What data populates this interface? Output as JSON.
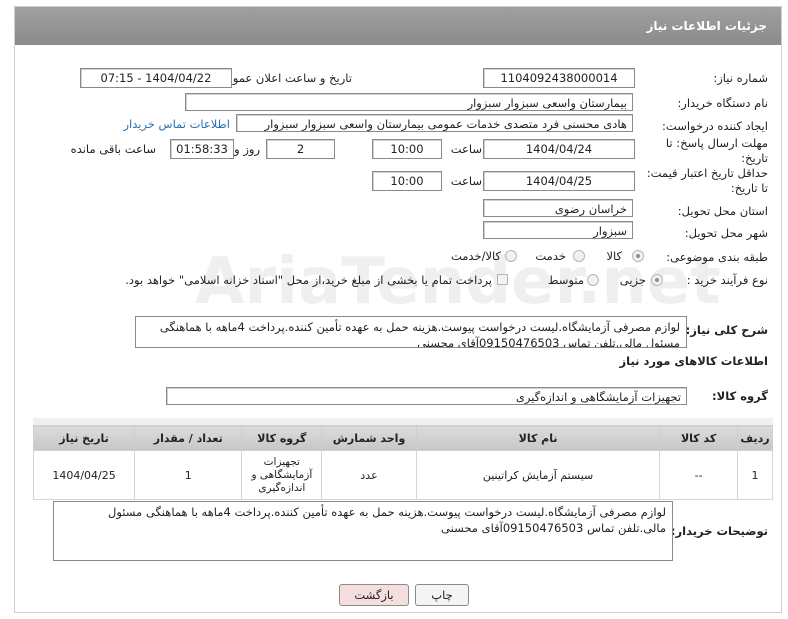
{
  "header": {
    "title": "جزئیات اطلاعات نیاز"
  },
  "form": {
    "need_number_label": "شماره نیاز:",
    "need_number": "1104092438000014",
    "announce_label": "تاریخ و ساعت اعلان عمومی:",
    "announce_value": "1404/04/22 - 07:15",
    "buyer_org_label": "نام دستگاه خریدار:",
    "buyer_org": "بیمارستان واسعی سبزوار سبزوار",
    "creator_label": "ایجاد کننده درخواست:",
    "creator": "هادی محسنی فرد متصدی خدمات عمومی بیمارستان واسعی سبزوار سبزوار",
    "contact_link": "اطلاعات تماس خریدار",
    "deadline_label_1": "مهلت ارسال پاسخ: تا",
    "deadline_label_2": "تاریخ:",
    "deadline_date": "1404/04/24",
    "time_label": "ساعت",
    "deadline_time": "10:00",
    "days_value": "2",
    "days_label": "روز و",
    "remaining_time": "01:58:33",
    "remaining_label": "ساعت باقی مانده",
    "price_label_1": "حداقل تاریخ اعتبار قیمت:",
    "price_label_2": "تا تاریخ:",
    "price_date": "1404/04/25",
    "price_time_label": "ساعت",
    "price_time": "10:00",
    "province_label": "استان محل تحویل:",
    "province": "خراسان رضوی",
    "city_label": "شهر محل تحویل:",
    "city": "سبزوار",
    "category_label": "طبقه بندی موضوعی:",
    "category_options": [
      "کالا",
      "خدمت",
      "کالا/خدمت"
    ],
    "process_label": "نوع فرآیند خرید :",
    "process_options": [
      "جزیی",
      "متوسط"
    ],
    "payment_note": "پرداخت تمام یا بخشی از مبلغ خرید،از محل \"اسناد خزانه اسلامی\" خواهد بود.",
    "description_label": "شرح کلی نیاز:",
    "description": "لوازم مصرفی آزمایشگاه.لیست درخواست پیوست.هزینه حمل به عهده تأمین کننده.پرداخت 4ماهه با هماهنگی مسئول مالی.تلفن تماس 09150476503آقای محسنی"
  },
  "goods": {
    "section_title": "اطلاعات کالاهای مورد نیاز",
    "group_label": "گروه کالا:",
    "group_value": "تجهیزات آزمایشگاهی و اندازه‌گیری",
    "columns": [
      "ردیف",
      "کد کالا",
      "نام کالا",
      "واحد شمارش",
      "گروه کالا",
      "تعداد / مقدار",
      "تاریخ نیاز"
    ],
    "rows": [
      {
        "index": "1",
        "code": "--",
        "name": "سیستم آزمایش کراتینین",
        "unit": "عدد",
        "group": "تجهیزات آزمایشگاهی و اندازه‌گیری",
        "qty": "1",
        "date": "1404/04/25"
      }
    ]
  },
  "buyer_notes": {
    "label": "توضیحات خریدار:",
    "text": "لوازم مصرفی آزمایشگاه.لیست درخواست پیوست.هزینه حمل به عهده تأمین کننده.پرداخت 4ماهه با هماهنگی مسئول مالی.تلفن تماس 09150476503آقای محسنی"
  },
  "buttons": {
    "back": "بازگشت",
    "print": "چاپ"
  },
  "colors": {
    "header": "#909090",
    "link": "#2a6fb0",
    "back_button": "#f7dede",
    "print_button": "#f4f4f4"
  }
}
